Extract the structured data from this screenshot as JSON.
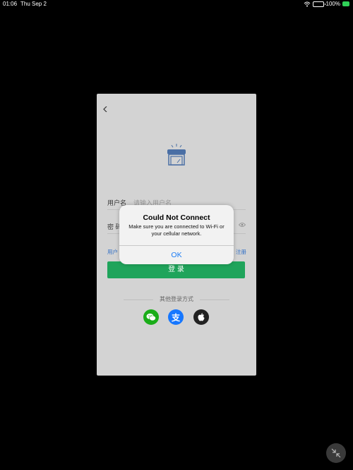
{
  "status": {
    "time": "01:06",
    "date": "Thu Sep 2",
    "battery_percent": "100%",
    "wifi_icon": "wifi-icon",
    "battery_icon": "battery-icon"
  },
  "app": {
    "back_icon": "chevron-left-icon",
    "logo_icon": "store-icon",
    "username_label": "用户名",
    "username_placeholder": "请输入用户名",
    "password_label": "密 码",
    "eye_icon": "eye-icon",
    "left_link": "用户",
    "right_link": "注册",
    "login_button": "登 录",
    "other_login": "其他登录方式",
    "social": [
      {
        "name": "wechat",
        "icon": "wechat-icon",
        "color": "#1aad19"
      },
      {
        "name": "alipay",
        "icon": "alipay-icon",
        "color": "#1677ff",
        "glyph": "支"
      },
      {
        "name": "apple",
        "icon": "apple-icon",
        "color": "#222222"
      }
    ]
  },
  "alert": {
    "title": "Could Not Connect",
    "message": "Make sure you are connected to Wi-Fi or your cellular network.",
    "ok_label": "OK"
  },
  "colors": {
    "accent_green": "#1fa45b",
    "link_blue": "#2f6ec5",
    "ios_blue": "#1a7cf5"
  }
}
